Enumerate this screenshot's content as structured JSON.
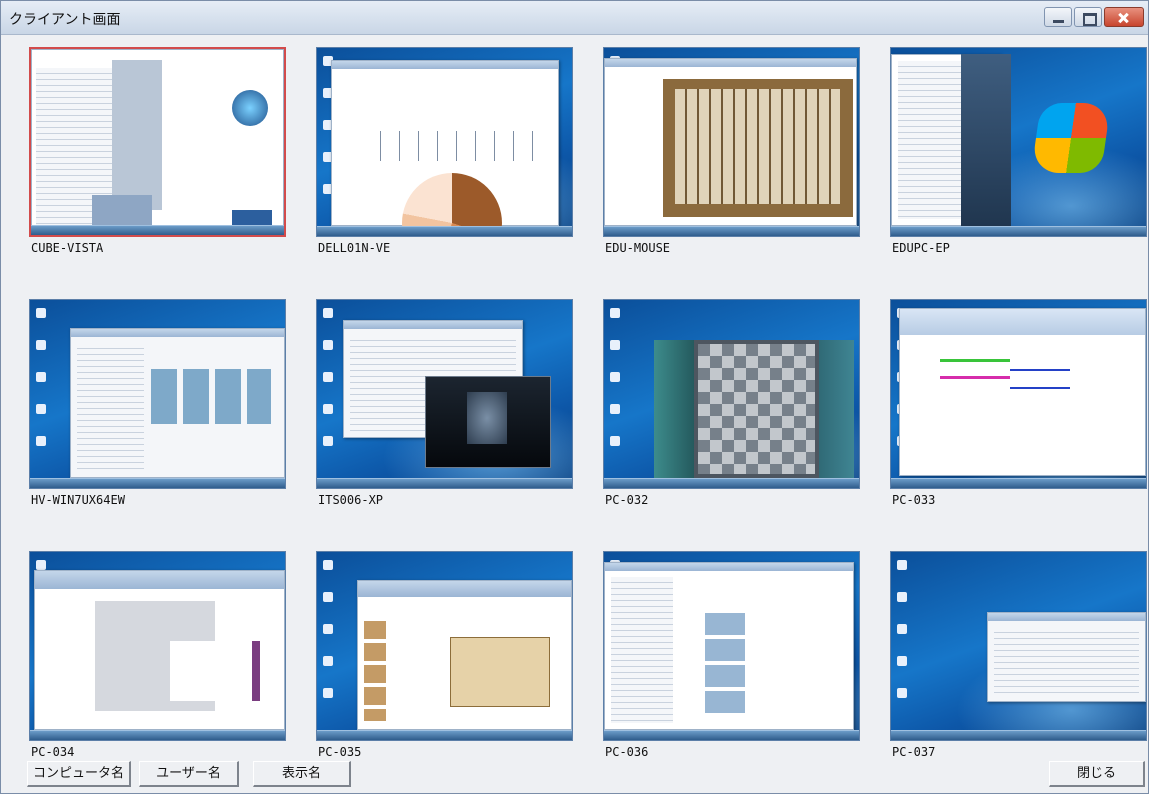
{
  "window": {
    "title": "クライアント画面"
  },
  "clients": [
    {
      "name": "CUBE-VISTA",
      "selected": true,
      "theme": "vista"
    },
    {
      "name": "DELL01N-VE",
      "selected": false,
      "theme": "excel"
    },
    {
      "name": "EDU-MOUSE",
      "selected": false,
      "theme": "mahjong"
    },
    {
      "name": "EDUPC-EP",
      "selected": false,
      "theme": "startmenu"
    },
    {
      "name": "HV-WIN7UX64EW",
      "selected": false,
      "theme": "explorer"
    },
    {
      "name": "ITS006-XP",
      "selected": false,
      "theme": "media"
    },
    {
      "name": "PC-032",
      "selected": false,
      "theme": "chess"
    },
    {
      "name": "PC-033",
      "selected": false,
      "theme": "paint"
    },
    {
      "name": "PC-034",
      "selected": false,
      "theme": "powerpoint"
    },
    {
      "name": "PC-035",
      "selected": false,
      "theme": "powerpoint2"
    },
    {
      "name": "PC-036",
      "selected": false,
      "theme": "explorer2"
    },
    {
      "name": "PC-037",
      "selected": false,
      "theme": "desktop"
    }
  ],
  "footer": {
    "computer_name_label": "コンピュータ名",
    "user_name_label": "ユーザー名",
    "display_name_label": "表示名",
    "close_label": "閉じる"
  }
}
